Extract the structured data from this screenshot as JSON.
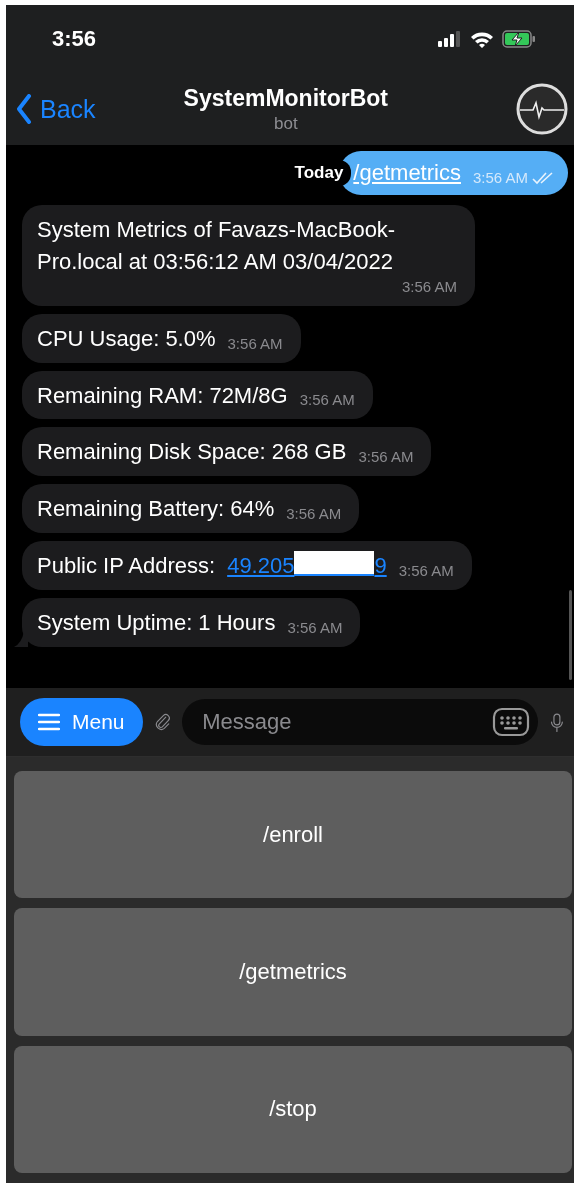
{
  "status_bar": {
    "time": "3:56",
    "battery_charging": true
  },
  "header": {
    "back": "Back",
    "title": "SystemMonitorBot",
    "subtitle": "bot"
  },
  "date_label": "Today",
  "messages": [
    {
      "kind": "out",
      "link": "/getmetrics",
      "time": "3:56 AM",
      "read": true
    },
    {
      "kind": "in",
      "text": "System Metrics of Favazs-MacBook-Pro.local at 03:56:12 AM 03/04/2022",
      "time": "3:56 AM"
    },
    {
      "kind": "in",
      "text": "CPU Usage: 5.0%",
      "time": "3:56 AM"
    },
    {
      "kind": "in",
      "text": "Remaining RAM: 72M/8G",
      "time": "3:56 AM"
    },
    {
      "kind": "in",
      "text": "Remaining Disk Space: 268 GB",
      "time": "3:56 AM"
    },
    {
      "kind": "in",
      "text": "Remaining Battery: 64%",
      "time": "3:56 AM"
    },
    {
      "kind": "in-link",
      "text": "Public IP Address: ",
      "link_parts": [
        "49.205",
        "9"
      ],
      "time": "3:56 AM"
    },
    {
      "kind": "in",
      "text": "System Uptime: 1 Hours",
      "time": "3:56 AM",
      "tail": true
    }
  ],
  "composer": {
    "menu": "Menu",
    "placeholder": "Message"
  },
  "keyboard": [
    "/enroll",
    "/getmetrics",
    "/stop"
  ]
}
